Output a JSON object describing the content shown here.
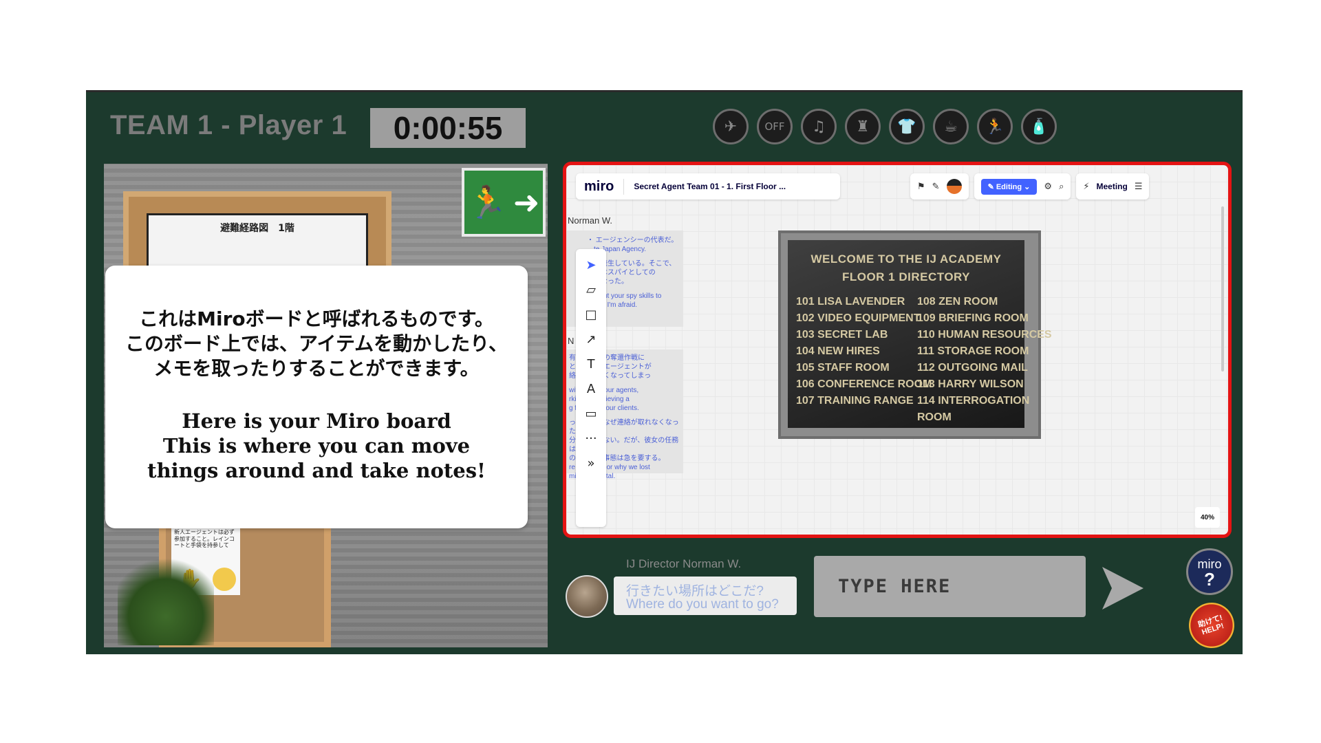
{
  "header": {
    "team_title": "TEAM 1 - Player 1",
    "timer": "0:00:55"
  },
  "location_icons": [
    {
      "name": "globe-icon",
      "glyph": "✈"
    },
    {
      "name": "off-sign-icon",
      "glyph": "OFF"
    },
    {
      "name": "piano-icon",
      "glyph": "♫"
    },
    {
      "name": "eiffel-tower-icon",
      "glyph": "♜"
    },
    {
      "name": "shirt-icon",
      "glyph": "👕"
    },
    {
      "name": "cafe-icon",
      "glyph": "☕"
    },
    {
      "name": "running-icon",
      "glyph": "🏃"
    },
    {
      "name": "spray-can-icon",
      "glyph": "🧴"
    }
  ],
  "scene": {
    "map_title": "避難経路図　1階",
    "note_text": "新人エージェントは必ず参加すること。レインコートと手袋を持参して"
  },
  "overlay": {
    "jp_lines": [
      "これはMiroボードと呼ばれるものです。",
      "このボード上では、アイテムを動かしたり、",
      "メモを取ったりすることができます。"
    ],
    "en_lines": [
      "Here is your Miro board",
      "This is where you can move",
      "things around and take notes!"
    ]
  },
  "miro": {
    "logo": "miro",
    "board_title": "Secret Agent Team 01 - 1. First Floor ...",
    "editing_label": "Editing",
    "meeting_label": "Meeting",
    "zoom": "40%",
    "frame_label_1": "Norman W.",
    "frame_label_2": "N      W.",
    "doc1": [
      "・   エージェンシーの代表だ。",
      "　te Japan Agency.",
      "",
      "　が発生している。そこで、",
      "　とはスパイとしての",
      "　になった。",
      "",
      "　o put your spy skills to",
      "　ted. I'm afraid."
    ],
    "doc2": [
      "有名な絵画の奪還作戦に",
      "と呼ばれるエージェントが",
      "絡が取れなくなってしまっ",
      "",
      "with one of our agents,",
      "rking on retrieving a",
      "g for one of our clients.",
      "",
      "ったのか、なぜ連絡が取れなくなった",
      "分かっていない。だが、彼女の任務は",
      "のであり、事態は急を要する。",
      "re she went or why we lost",
      "mission is vital."
    ],
    "directory": {
      "title1": "WELCOME TO THE IJ ACADEMY",
      "title2": "FLOOR 1 DIRECTORY",
      "left": [
        "101  LISA LAVENDER",
        "102  VIDEO EQUIPMENT",
        "103  SECRET LAB",
        "104  NEW HIRES",
        "105  STAFF ROOM",
        "106  CONFERENCE ROOM",
        "107  TRAINING RANGE"
      ],
      "right": [
        "108  ZEN ROOM",
        "109  BRIEFING ROOM",
        "110  HUMAN RESOURCES",
        "111  STORAGE ROOM",
        "112  OUTGOING MAIL",
        "113  HARRY WILSON",
        "114  INTERROGATION",
        "       ROOM"
      ]
    }
  },
  "chat": {
    "director_name": "IJ Director Norman W.",
    "message_jp": "行きたい場所はどこだ?",
    "message_en": "Where do you want to go?",
    "input_placeholder": "TYPE HERE"
  },
  "help": {
    "miro_label": "miro",
    "question": "?",
    "help_jp": "助けて!",
    "help_en": "HELP!"
  }
}
